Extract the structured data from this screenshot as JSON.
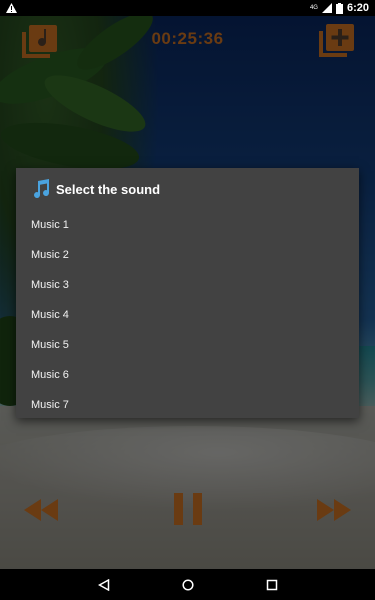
{
  "status_bar": {
    "time": "6:20",
    "network_label": "4G"
  },
  "player": {
    "timer": "00:25:36",
    "accent_color": "#6a3b12"
  },
  "dialog": {
    "title": "Select the sound",
    "options": [
      "Music 1",
      "Music 2",
      "Music 3",
      "Music 4",
      "Music 5",
      "Music 6",
      "Music 7"
    ]
  },
  "icons": {
    "alert": "warning-triangle-icon",
    "signal": "signal-icon",
    "battery": "battery-icon",
    "library": "music-library-icon",
    "add": "add-playlist-icon",
    "note": "music-note-icon",
    "rewind": "rewind-icon",
    "pause": "pause-icon",
    "forward": "fast-forward-icon",
    "back": "back-icon",
    "home": "home-icon",
    "recents": "recents-icon"
  }
}
